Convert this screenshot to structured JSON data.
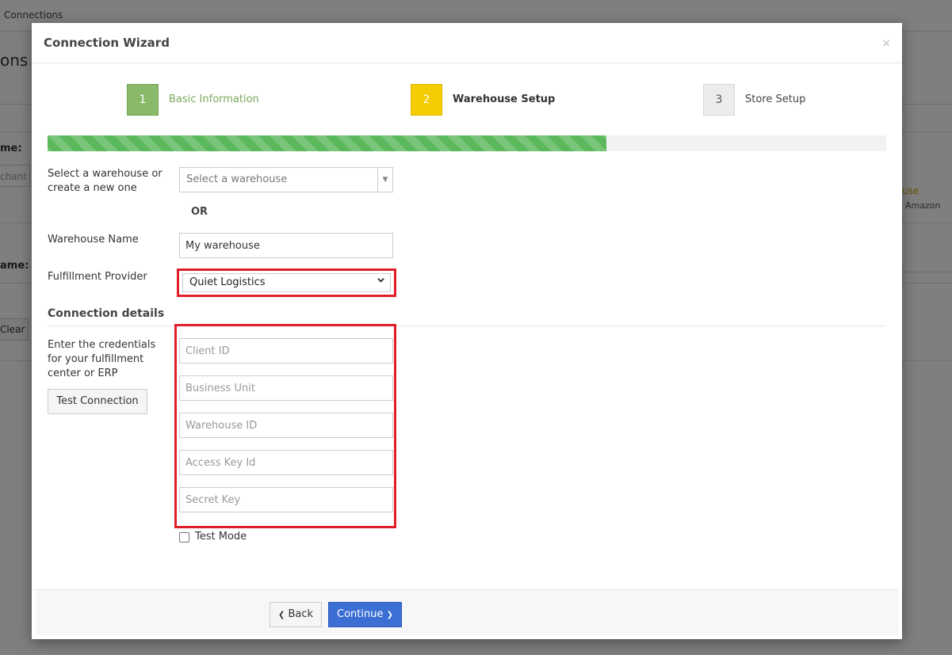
{
  "background": {
    "breadcrumb": "Connections",
    "page_title_fragment": "ons",
    "name_label_1": "me:",
    "merchant_fragment": "chant",
    "name_label_2": "ame:",
    "clear_fragment": "Clear",
    "warehouse_link_fragment": "use",
    "amazon_fragment": "Amazon"
  },
  "modal": {
    "title": "Connection Wizard",
    "close_glyph": "×"
  },
  "steps": [
    {
      "number": "1",
      "label": "Basic Information",
      "state": "complete"
    },
    {
      "number": "2",
      "label": "Warehouse Setup",
      "state": "active"
    },
    {
      "number": "3",
      "label": "Store Setup",
      "state": "pending"
    }
  ],
  "progress": {
    "value": 0.666,
    "color": "#5cb85c"
  },
  "form": {
    "select_warehouse_label": "Select a warehouse or create a new one",
    "select_warehouse_placeholder": "Select a warehouse",
    "or_text": "OR",
    "warehouse_name_label": "Warehouse Name",
    "warehouse_name_value": "My warehouse",
    "provider_label": "Fulfillment Provider",
    "provider_value": "Quiet Logistics",
    "connection_details_title": "Connection details",
    "credentials_help": "Enter the credentials for your fulfillment center or ERP",
    "test_connection_label": "Test Connection",
    "fields": [
      {
        "placeholder": "Client ID"
      },
      {
        "placeholder": "Business Unit"
      },
      {
        "placeholder": "Warehouse ID"
      },
      {
        "placeholder": "Access Key Id"
      },
      {
        "placeholder": "Secret Key"
      }
    ],
    "test_mode_label": "Test Mode",
    "test_mode_checked": false
  },
  "footer": {
    "back_label": "Back",
    "continue_label": "Continue"
  },
  "colors": {
    "highlight": "#e01e2a",
    "primary": "#3b6fd4",
    "step_complete": "#8bb96a",
    "step_active": "#f4cc00"
  },
  "icons": {
    "back": "chevron-left-icon",
    "continue": "chevron-right-icon",
    "provider_dropdown": "chevron-down-icon",
    "warehouse_dropdown": "caret-down-icon"
  }
}
